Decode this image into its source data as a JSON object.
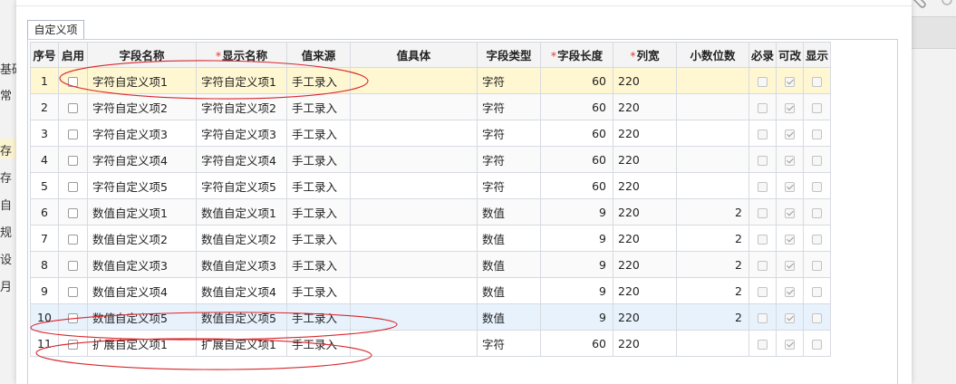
{
  "tab_label": "自定义项",
  "columns": [
    {
      "label": "序号",
      "required": false
    },
    {
      "label": "启用",
      "required": false
    },
    {
      "label": "字段名称",
      "required": false
    },
    {
      "label": "显示名称",
      "required": true
    },
    {
      "label": "值来源",
      "required": false
    },
    {
      "label": "值具体",
      "required": false
    },
    {
      "label": "字段类型",
      "required": false
    },
    {
      "label": "字段长度",
      "required": true
    },
    {
      "label": "列宽",
      "required": true
    },
    {
      "label": "小数位数",
      "required": false
    },
    {
      "label": "必录",
      "required": false
    },
    {
      "label": "可改",
      "required": false
    },
    {
      "label": "显示",
      "required": false
    }
  ],
  "rows": [
    {
      "no": "1",
      "field": "字符自定义项1",
      "display": "字符自定义项1",
      "source": "手工录入",
      "detail": "",
      "type": "字符",
      "length": "60",
      "width": "220",
      "decimals": "",
      "enabled": false,
      "must": false,
      "editable": true,
      "show": false
    },
    {
      "no": "2",
      "field": "字符自定义项2",
      "display": "字符自定义项2",
      "source": "手工录入",
      "detail": "",
      "type": "字符",
      "length": "60",
      "width": "220",
      "decimals": "",
      "enabled": false,
      "must": false,
      "editable": true,
      "show": false
    },
    {
      "no": "3",
      "field": "字符自定义项3",
      "display": "字符自定义项3",
      "source": "手工录入",
      "detail": "",
      "type": "字符",
      "length": "60",
      "width": "220",
      "decimals": "",
      "enabled": false,
      "must": false,
      "editable": true,
      "show": false
    },
    {
      "no": "4",
      "field": "字符自定义项4",
      "display": "字符自定义项4",
      "source": "手工录入",
      "detail": "",
      "type": "字符",
      "length": "60",
      "width": "220",
      "decimals": "",
      "enabled": false,
      "must": false,
      "editable": true,
      "show": false
    },
    {
      "no": "5",
      "field": "字符自定义项5",
      "display": "字符自定义项5",
      "source": "手工录入",
      "detail": "",
      "type": "字符",
      "length": "60",
      "width": "220",
      "decimals": "",
      "enabled": false,
      "must": false,
      "editable": true,
      "show": false
    },
    {
      "no": "6",
      "field": "数值自定义项1",
      "display": "数值自定义项1",
      "source": "手工录入",
      "detail": "",
      "type": "数值",
      "length": "9",
      "width": "220",
      "decimals": "2",
      "enabled": false,
      "must": false,
      "editable": true,
      "show": false
    },
    {
      "no": "7",
      "field": "数值自定义项2",
      "display": "数值自定义项2",
      "source": "手工录入",
      "detail": "",
      "type": "数值",
      "length": "9",
      "width": "220",
      "decimals": "2",
      "enabled": false,
      "must": false,
      "editable": true,
      "show": false
    },
    {
      "no": "8",
      "field": "数值自定义项3",
      "display": "数值自定义项3",
      "source": "手工录入",
      "detail": "",
      "type": "数值",
      "length": "9",
      "width": "220",
      "decimals": "2",
      "enabled": false,
      "must": false,
      "editable": true,
      "show": false
    },
    {
      "no": "9",
      "field": "数值自定义项4",
      "display": "数值自定义项4",
      "source": "手工录入",
      "detail": "",
      "type": "数值",
      "length": "9",
      "width": "220",
      "decimals": "2",
      "enabled": false,
      "must": false,
      "editable": true,
      "show": false
    },
    {
      "no": "10",
      "field": "数值自定义项5",
      "display": "数值自定义项5",
      "source": "手工录入",
      "detail": "",
      "type": "数值",
      "length": "9",
      "width": "220",
      "decimals": "2",
      "enabled": false,
      "must": false,
      "editable": true,
      "show": false
    },
    {
      "no": "11",
      "field": "扩展自定义项1",
      "display": "扩展自定义项1",
      "source": "手工录入",
      "detail": "",
      "type": "字符",
      "length": "60",
      "width": "220",
      "decimals": "",
      "enabled": false,
      "must": false,
      "editable": true,
      "show": false
    }
  ],
  "selected_row": 0,
  "hover_row": 9,
  "background": {
    "left_items": [
      "基础",
      "常",
      "存",
      "存",
      "自",
      "规",
      "设",
      "月"
    ]
  },
  "colors": {
    "required": "#e53935",
    "selected": "#fff7d1",
    "hover": "#e8f2fd",
    "annotation": "#d9262b",
    "border": "#d6dae0"
  }
}
